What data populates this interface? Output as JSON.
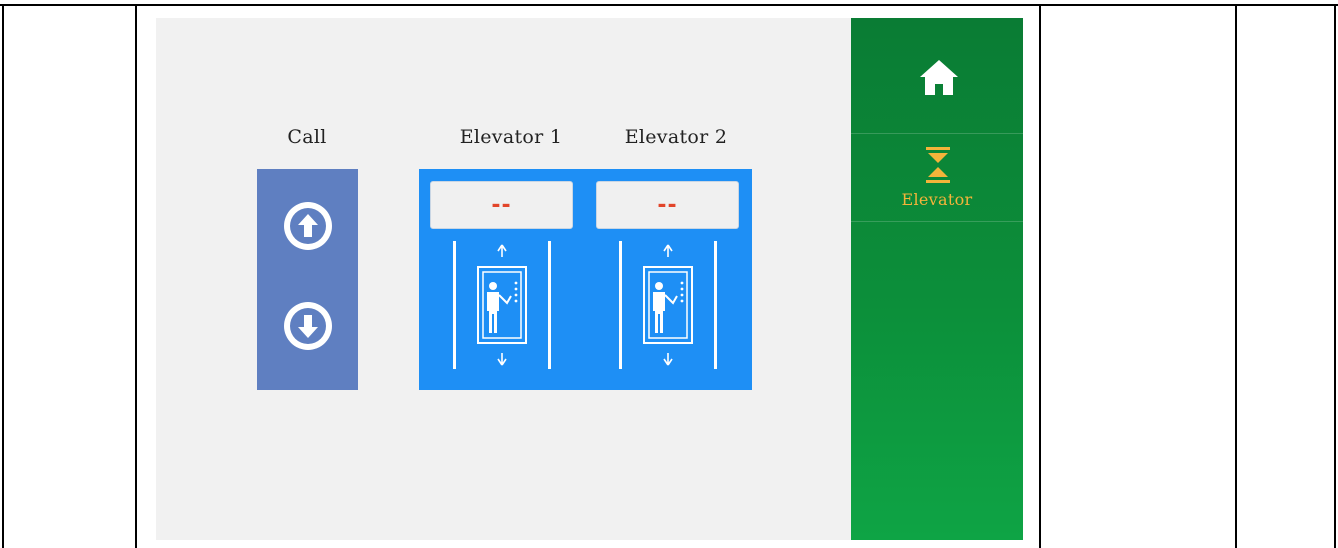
{
  "labels": {
    "call": "Call",
    "elevator1": "Elevator 1",
    "elevator2": "Elevator 2"
  },
  "elevators": [
    {
      "floor_display": "--"
    },
    {
      "floor_display": "--"
    }
  ],
  "sidebar": {
    "home_icon": "home-icon",
    "elevator_icon": "elevator-icon",
    "elevator_label": "Elevator"
  },
  "colors": {
    "call_panel": "#5f7fc1",
    "elevator_panel": "#1e8ff5",
    "floor_digits": "#e2452a",
    "sidebar_green": "#0c8f3a",
    "sidebar_active_text": "#f4b43a"
  }
}
